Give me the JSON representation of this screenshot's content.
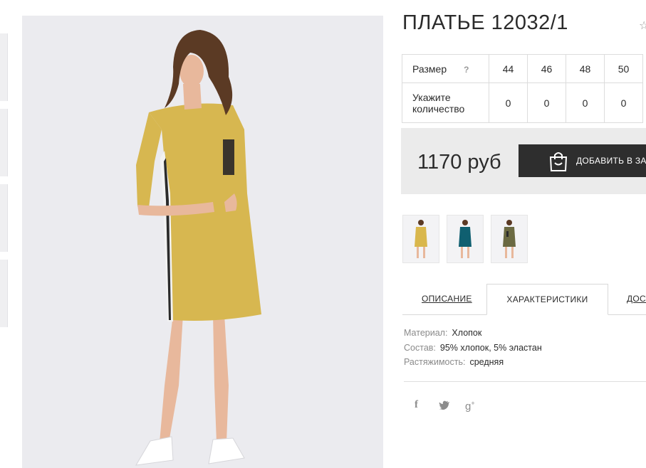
{
  "product": {
    "title": "ПЛАТЬЕ 12032/1"
  },
  "icons": {
    "favorite": "star-outline-icon",
    "help": "question-icon",
    "cart": "shopping-bag-icon",
    "social": [
      "facebook-icon",
      "twitter-icon",
      "google-plus-icon"
    ]
  },
  "size_table": {
    "size_label": "Размер",
    "help_mark": "?",
    "quantity_label_line1": "Укажите",
    "quantity_label_line2": "количество",
    "sizes": [
      "44",
      "46",
      "48",
      "50"
    ],
    "quantities": [
      "0",
      "0",
      "0",
      "0"
    ]
  },
  "price": {
    "value": "1170 руб",
    "add_to_cart_label": "ДОБАВИТЬ В ЗА"
  },
  "color_variants": [
    {
      "color": "#d9b74c"
    },
    {
      "color": "#0f5f70"
    },
    {
      "color": "#6b6a42"
    }
  ],
  "tabs": {
    "description": "ОПИСАНИЕ",
    "characteristics": "ХАРАКТЕРИСТИКИ",
    "delivery": "ДОСТ"
  },
  "specs": [
    {
      "key": "Материал:",
      "value": "Хлопок"
    },
    {
      "key": "Состав:",
      "value": "95% хлопок, 5% эластан"
    },
    {
      "key": "Растяжимость:",
      "value": "средняя"
    }
  ],
  "colors": {
    "dress": "#d7b750",
    "hair": "#5b3a24",
    "skin": "#e8b89c",
    "background": "#ebebef",
    "button": "#2e2e2e",
    "price_box": "#ebebeb"
  }
}
